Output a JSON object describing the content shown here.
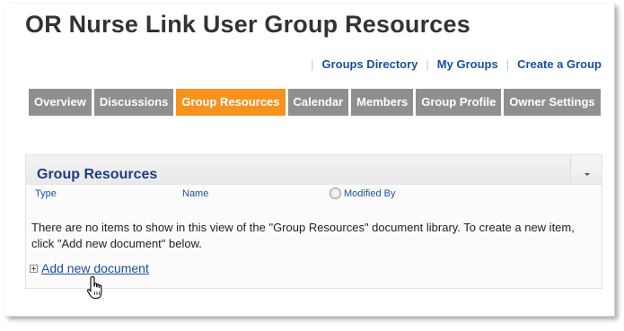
{
  "page": {
    "title": "OR Nurse Link User Group Resources"
  },
  "top_links": [
    {
      "label": "Groups Directory"
    },
    {
      "label": "My Groups"
    },
    {
      "label": "Create a Group"
    }
  ],
  "tabs": [
    {
      "label": "Overview",
      "active": false
    },
    {
      "label": "Discussions",
      "active": false
    },
    {
      "label": "Group Resources",
      "active": true
    },
    {
      "label": "Calendar",
      "active": false
    },
    {
      "label": "Members",
      "active": false
    },
    {
      "label": "Group Profile",
      "active": false
    },
    {
      "label": "Owner Settings",
      "active": false
    }
  ],
  "panel": {
    "title": "Group Resources",
    "columns": {
      "type": "Type",
      "name": "Name",
      "modified_by": "Modified By"
    },
    "empty_message": "There are no items to show in this view of the \"Group Resources\" document library. To create a new item, click \"Add new document\" below.",
    "add_link": "Add new document"
  },
  "colors": {
    "tab_inactive": "#8f8f8f",
    "tab_active": "#f6921e",
    "link": "#1a4fa0",
    "panel_title": "#1c3d86"
  },
  "icons": {
    "sort_radio": "radio-icon",
    "expand": "plus-box-icon",
    "pointer": "hand-cursor-icon",
    "panel_menu": "chevron-down-icon"
  }
}
